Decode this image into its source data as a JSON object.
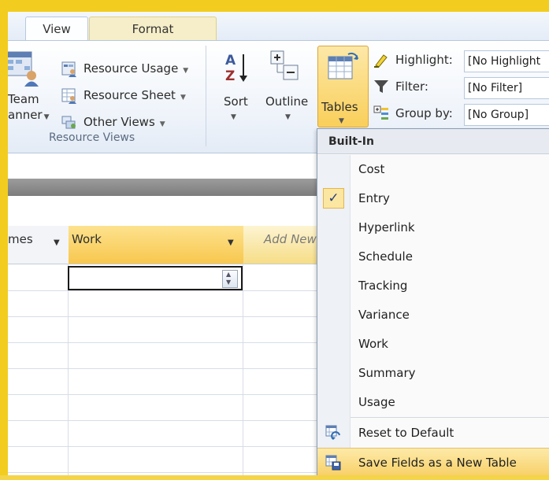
{
  "tabs": [
    {
      "label": "View"
    },
    {
      "label": "Format"
    }
  ],
  "ribbon": {
    "team_planner": [
      "Team",
      "anner"
    ],
    "resource_usage": "Resource Usage",
    "resource_sheet": "Resource Sheet",
    "other_views": "Other Views",
    "group_label": "Resource Views",
    "sort": "Sort",
    "outline": "Outline",
    "tables": "Tables",
    "highlight_label": "Highlight:",
    "highlight_value": "[No Highlight",
    "filter_label": "Filter:",
    "filter_value": "[No Filter]",
    "groupby_label": "Group by:",
    "groupby_value": "[No Group]"
  },
  "grid": {
    "columns": [
      "mes",
      "Work",
      "Add New"
    ]
  },
  "menu": {
    "header": "Built-In",
    "items": [
      {
        "label": "Cost",
        "checked": false
      },
      {
        "label": "Entry",
        "checked": true
      },
      {
        "label": "Hyperlink",
        "checked": false
      },
      {
        "label": "Schedule",
        "checked": false
      },
      {
        "label": "Tracking",
        "checked": false
      },
      {
        "label": "Variance",
        "checked": false
      },
      {
        "label": "Work",
        "checked": false
      },
      {
        "label": "Summary",
        "checked": false
      },
      {
        "label": "Usage",
        "checked": false
      }
    ],
    "reset": "Reset to Default",
    "save": "Save Fields as a New Table",
    "check_glyph": "✓"
  }
}
